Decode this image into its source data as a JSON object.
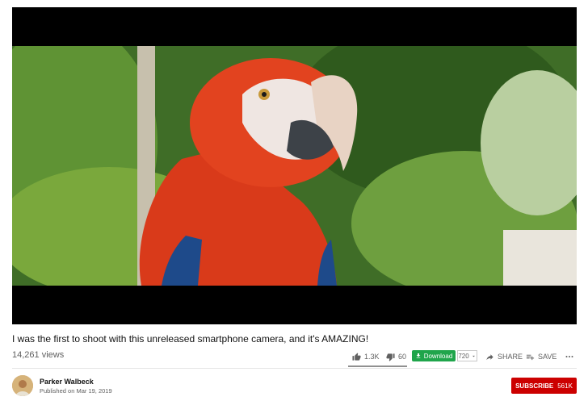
{
  "video": {
    "title": "I was the first to shoot with this unreleased smartphone camera, and it's AMAZING!",
    "views": "14,261 views",
    "likes": "1.3K",
    "dislikes": "60",
    "like_ratio": 0.956
  },
  "actions": {
    "download_label": "Download",
    "quality": "720",
    "share_label": "SHARE",
    "save_label": "SAVE"
  },
  "channel": {
    "name": "Parker Walbeck",
    "published": "Published on Mar 19, 2019"
  },
  "subscribe": {
    "label": "SUBSCRIBE",
    "count": "561K"
  },
  "colors": {
    "subscribe": "#cc0000",
    "download": "#1fa54b"
  },
  "icons": [
    "thumbs-up-icon",
    "thumbs-down-icon",
    "download-icon",
    "chevron-down-icon",
    "share-icon",
    "save-icon",
    "more-icon"
  ]
}
